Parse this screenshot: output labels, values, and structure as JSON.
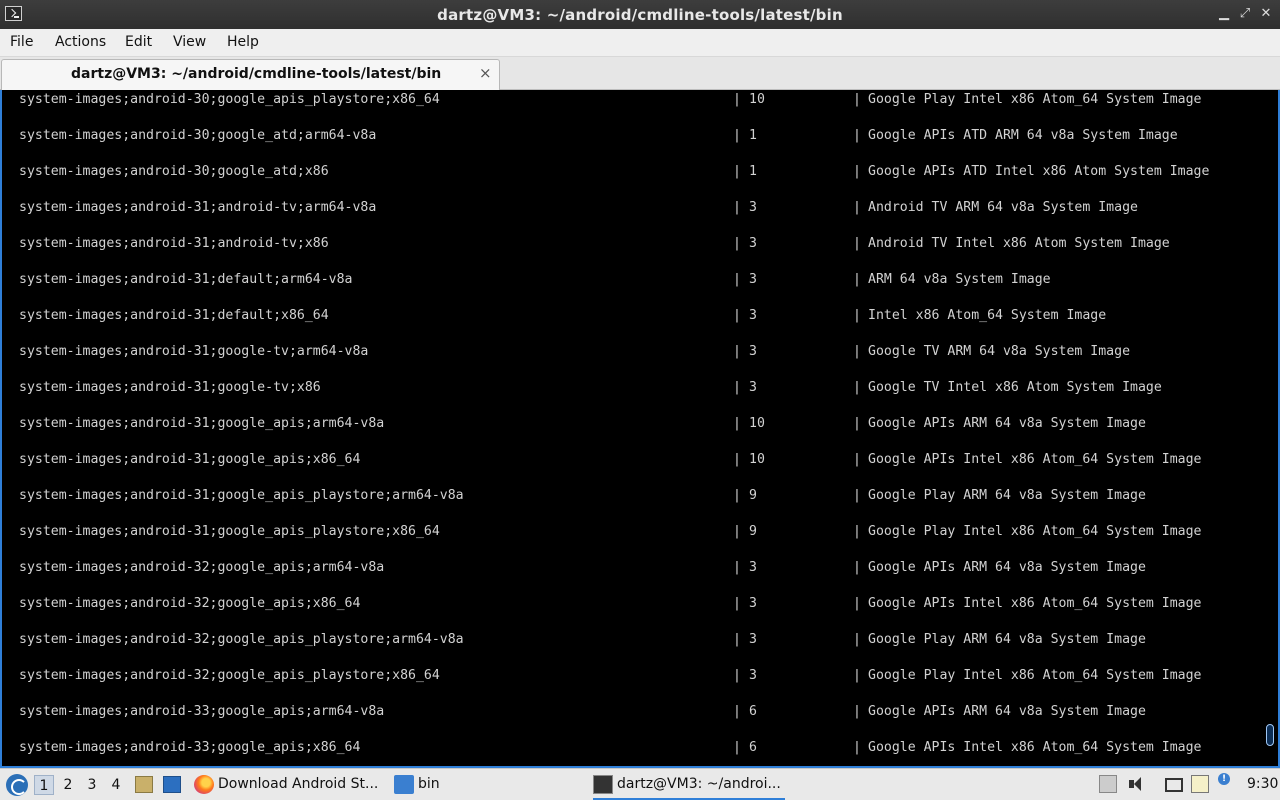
{
  "window": {
    "title": "dartz@VM3: ~/android/cmdline-tools/latest/bin",
    "minimize_glyph": "▁",
    "maximize_glyph": "⤢",
    "close_glyph": "✕"
  },
  "menubar": {
    "items": [
      "File",
      "Actions",
      "Edit",
      "View",
      "Help"
    ]
  },
  "tab": {
    "label": "dartz@VM3: ~/android/cmdline-tools/latest/bin",
    "close_glyph": "×"
  },
  "terminal": {
    "separator": "|",
    "rows": [
      {
        "path": "system-images;android-30;google_apis_playstore;x86_64",
        "version": "10",
        "description": "Google Play Intel x86 Atom_64 System Image"
      },
      {
        "path": "system-images;android-30;google_atd;arm64-v8a",
        "version": "1",
        "description": "Google APIs ATD ARM 64 v8a System Image"
      },
      {
        "path": "system-images;android-30;google_atd;x86",
        "version": "1",
        "description": "Google APIs ATD Intel x86 Atom System Image"
      },
      {
        "path": "system-images;android-31;android-tv;arm64-v8a",
        "version": "3",
        "description": "Android TV ARM 64 v8a System Image"
      },
      {
        "path": "system-images;android-31;android-tv;x86",
        "version": "3",
        "description": "Android TV Intel x86 Atom System Image"
      },
      {
        "path": "system-images;android-31;default;arm64-v8a",
        "version": "3",
        "description": "ARM 64 v8a System Image"
      },
      {
        "path": "system-images;android-31;default;x86_64",
        "version": "3",
        "description": "Intel x86 Atom_64 System Image"
      },
      {
        "path": "system-images;android-31;google-tv;arm64-v8a",
        "version": "3",
        "description": "Google TV ARM 64 v8a System Image"
      },
      {
        "path": "system-images;android-31;google-tv;x86",
        "version": "3",
        "description": "Google TV Intel x86 Atom System Image"
      },
      {
        "path": "system-images;android-31;google_apis;arm64-v8a",
        "version": "10",
        "description": "Google APIs ARM 64 v8a System Image"
      },
      {
        "path": "system-images;android-31;google_apis;x86_64",
        "version": "10",
        "description": "Google APIs Intel x86 Atom_64 System Image"
      },
      {
        "path": "system-images;android-31;google_apis_playstore;arm64-v8a",
        "version": "9",
        "description": "Google Play ARM 64 v8a System Image"
      },
      {
        "path": "system-images;android-31;google_apis_playstore;x86_64",
        "version": "9",
        "description": "Google Play Intel x86 Atom_64 System Image"
      },
      {
        "path": "system-images;android-32;google_apis;arm64-v8a",
        "version": "3",
        "description": "Google APIs ARM 64 v8a System Image"
      },
      {
        "path": "system-images;android-32;google_apis;x86_64",
        "version": "3",
        "description": "Google APIs Intel x86 Atom_64 System Image"
      },
      {
        "path": "system-images;android-32;google_apis_playstore;arm64-v8a",
        "version": "3",
        "description": "Google Play ARM 64 v8a System Image"
      },
      {
        "path": "system-images;android-32;google_apis_playstore;x86_64",
        "version": "3",
        "description": "Google Play Intel x86 Atom_64 System Image"
      },
      {
        "path": "system-images;android-33;google_apis;arm64-v8a",
        "version": "6",
        "description": "Google APIs ARM 64 v8a System Image"
      },
      {
        "path": "system-images;android-33;google_apis;x86_64",
        "version": "6",
        "description": "Google APIs Intel x86 Atom_64 System Image"
      }
    ]
  },
  "taskbar": {
    "workspaces": [
      "1",
      "2",
      "3",
      "4"
    ],
    "tasks": [
      {
        "label": "Download Android St...",
        "icon": "firefox-icon"
      },
      {
        "label": "bin",
        "icon": "folder-icon"
      },
      {
        "label": "dartz@VM3: ~/androi...",
        "icon": "terminal-icon"
      }
    ],
    "info_glyph": "!",
    "clock": "9:30"
  },
  "colors": {
    "accent": "#2f7fd8",
    "terminal_bg": "#000000",
    "terminal_fg": "#d2d2d2"
  }
}
